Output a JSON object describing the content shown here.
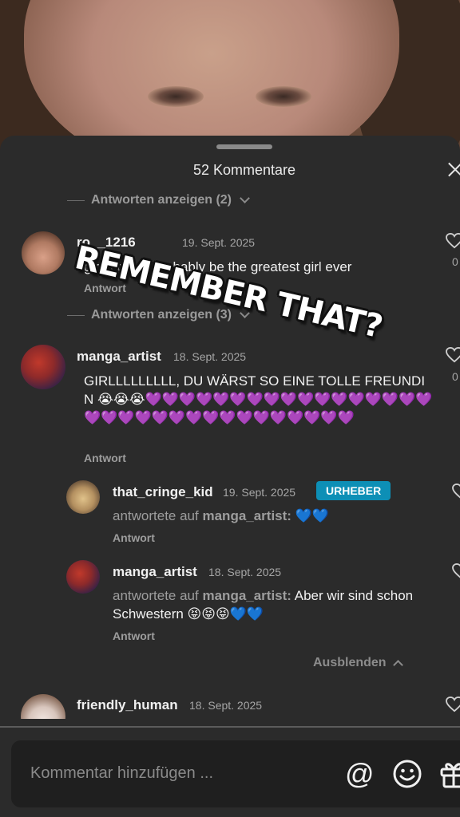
{
  "sheet": {
    "title": "52 Kommentare"
  },
  "replies_toggle_top": {
    "label": "Antworten anzeigen (2)"
  },
  "comments": [
    {
      "username": "ro__1216",
      "date": "19. Sept. 2025",
      "text": "girl u could probably be the greatest girl ever",
      "reply_label": "Antwort",
      "likes": "0"
    },
    {
      "username": "manga_artist",
      "date": "18. Sept. 2025",
      "text": "GIRLLLLLLLLL, DU WÄRST SO EINE TOLLE FREUNDIN 😭😭😭💜💜💜💜💜💜💜💜💜💜💜💜💜💜💜💜💜💜💜💜💜💜💜💜💜💜💜💜💜💜💜💜💜",
      "reply_label": "Antwort",
      "likes": "0"
    }
  ],
  "replies_toggle_mid": {
    "label": "Antworten anzeigen (3)"
  },
  "replies": [
    {
      "username": "that_cringe_kid",
      "date": "19. Sept. 2025",
      "badge": "URHEBER",
      "prefix": "antwortete auf",
      "target": "manga_artist:",
      "text": " 💙💙",
      "reply_label": "Antwort"
    },
    {
      "username": "manga_artist",
      "date": "18. Sept. 2025",
      "prefix": "antwortete auf",
      "target": "manga_artist:",
      "text": " Aber wir sind schon Schwestern 😝😝😝💙💙",
      "reply_label": "Antwort"
    }
  ],
  "collapse": {
    "label": "Ausblenden"
  },
  "last_comment": {
    "username": "friendly_human",
    "date": "18. Sept. 2025"
  },
  "input": {
    "placeholder": "Kommentar hinzufügen ..."
  },
  "sticker": {
    "text": "REMEMBER THAT?"
  },
  "colors": {
    "sheet_bg": "#2b2b2b",
    "badge_bg": "#0d8fb6",
    "input_bg": "#1f1f1f"
  }
}
